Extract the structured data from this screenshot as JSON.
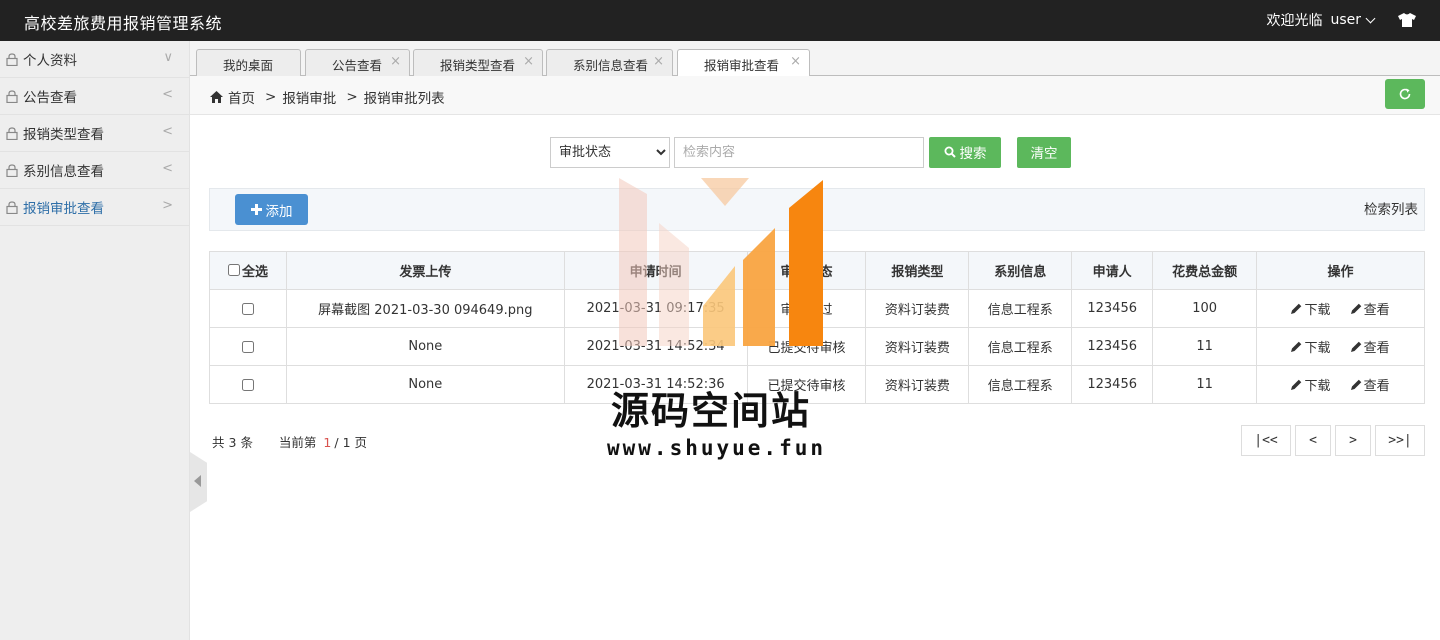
{
  "header": {
    "title": "高校差旅费用报销管理系统",
    "welcome": "欢迎光临",
    "user": "user",
    "icon": "tshirt-icon"
  },
  "sidebar": {
    "items": [
      {
        "label": "个人资料",
        "arrow": "∨"
      },
      {
        "label": "公告查看",
        "arrow": "<"
      },
      {
        "label": "报销类型查看",
        "arrow": "<"
      },
      {
        "label": "系别信息查看",
        "arrow": "<"
      },
      {
        "label": "报销审批查看",
        "arrow": ">"
      }
    ],
    "active_index": 4
  },
  "tabs": [
    {
      "label": "我的桌面",
      "close": ""
    },
    {
      "label": "公告查看",
      "close": "×"
    },
    {
      "label": "报销类型查看",
      "close": "×"
    },
    {
      "label": "系别信息查看",
      "close": "×"
    },
    {
      "label": "报销审批查看",
      "close": "×"
    }
  ],
  "breadcrumb": {
    "home": "首页",
    "sep": ">",
    "level1": "报销审批",
    "level2": "报销审批列表"
  },
  "search": {
    "status_select": "审批状态",
    "placeholder": "检索内容",
    "search_label": "搜索",
    "clear_label": "清空"
  },
  "toolbar": {
    "add_label": "添加",
    "list_title": "检索列表"
  },
  "table": {
    "select_all": "全选",
    "columns": [
      "发票上传",
      "申请时间",
      "审批状态",
      "报销类型",
      "系别信息",
      "申请人",
      "花费总金额",
      "操作"
    ],
    "rows": [
      {
        "invoice": "屏幕截图 2021-03-30 094649.png",
        "time": "2021-03-31 09:17:35",
        "status": "审核通过",
        "type": "资料订装费",
        "dept": "信息工程系",
        "applicant": "123456",
        "amount": "100"
      },
      {
        "invoice": "None",
        "time": "2021-03-31 14:52:34",
        "status": "已提交待审核",
        "type": "资料订装费",
        "dept": "信息工程系",
        "applicant": "123456",
        "amount": "11"
      },
      {
        "invoice": "None",
        "time": "2021-03-31 14:52:36",
        "status": "已提交待审核",
        "type": "资料订装费",
        "dept": "信息工程系",
        "applicant": "123456",
        "amount": "11"
      }
    ],
    "op_download": "下载",
    "op_view": "查看"
  },
  "pagination": {
    "total_prefix": "共",
    "total": "3",
    "total_suffix": "条",
    "current_prefix": "当前第",
    "current": "1",
    "of": "/",
    "pages": "1",
    "pages_suffix": "页",
    "first": "|<<",
    "prev": "<",
    "next": ">",
    "last": ">>|"
  },
  "watermark": {
    "name": "源码空间站",
    "url": "www.shuyue.fun"
  },
  "colors": {
    "topbar": "#222222",
    "accent_blue": "#4a90d2",
    "accent_green": "#5cb85c",
    "active_text": "#2f6fa8",
    "current_page": "#d9534f",
    "watermark_orange": "#f7941d"
  }
}
